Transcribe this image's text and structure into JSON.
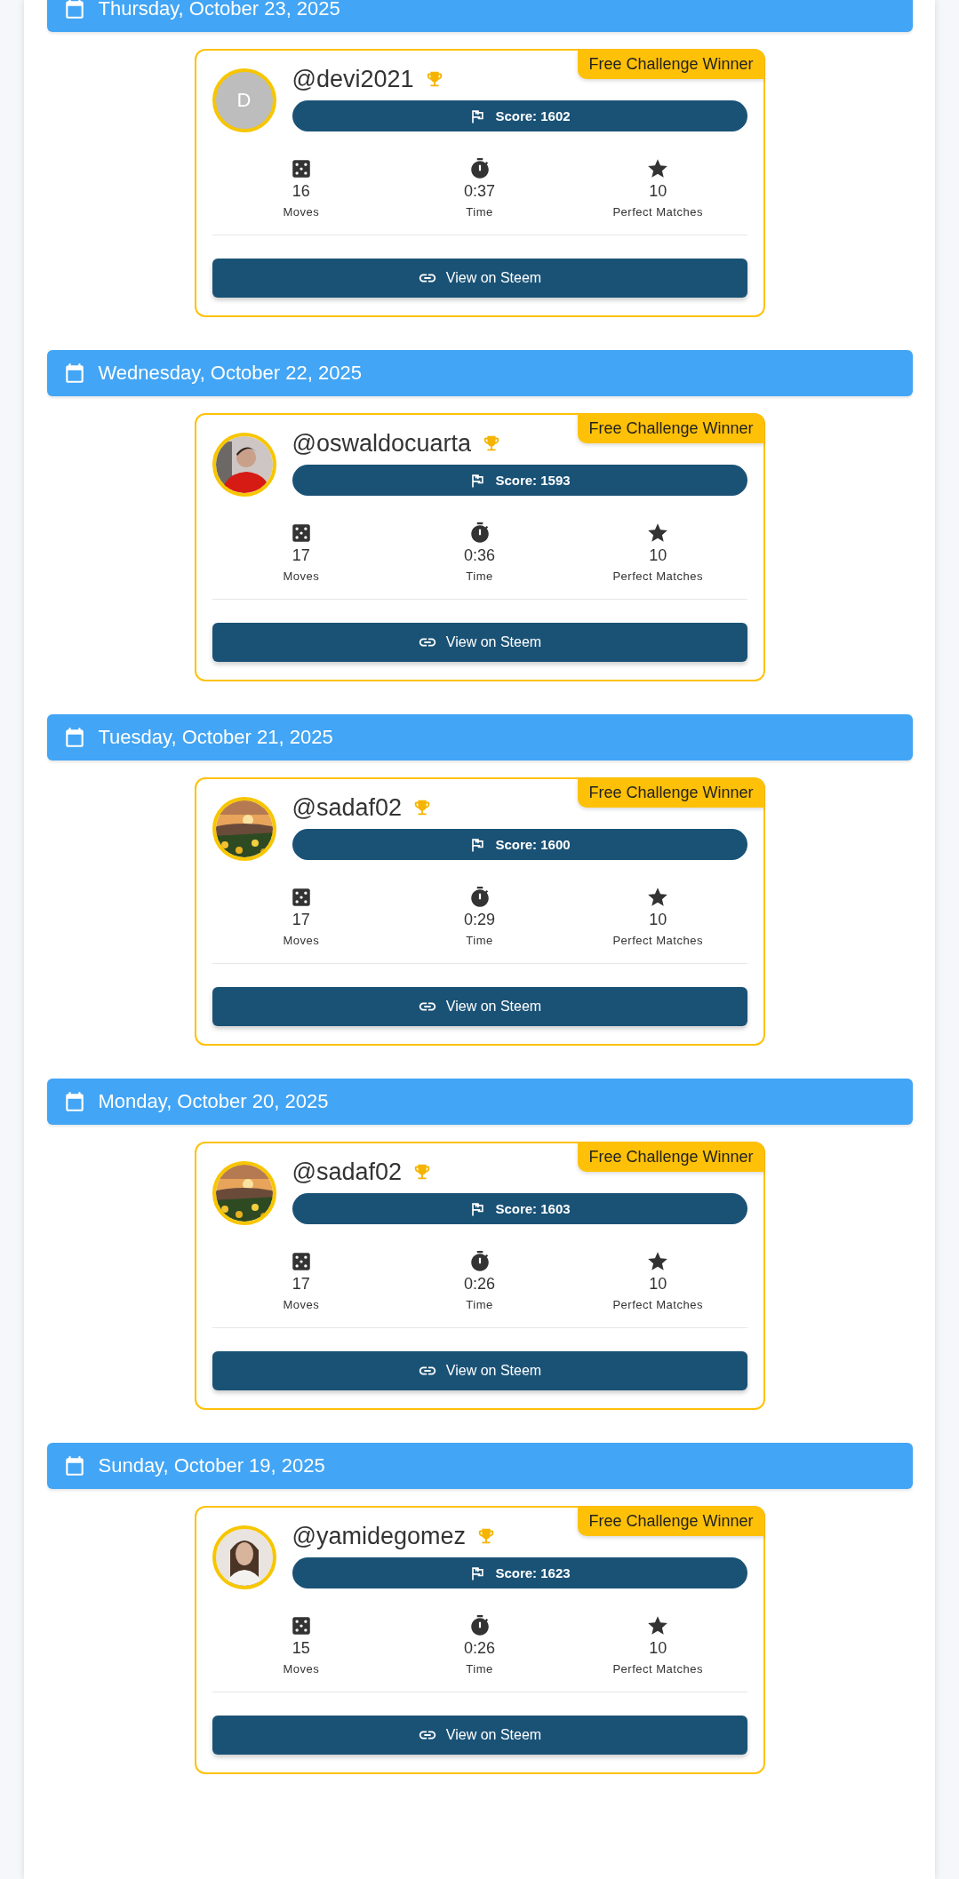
{
  "entries": [
    {
      "date": "Thursday, October 23, 2025",
      "user": "@devi2021",
      "avatar": {
        "kind": "letter",
        "initial": "D"
      },
      "badge": "Free Challenge Winner",
      "score": "Score: 1602",
      "stats": [
        {
          "kind": "moves",
          "value": "16",
          "label": "Moves"
        },
        {
          "kind": "time",
          "value": "0:37",
          "label": "Time"
        },
        {
          "kind": "matches",
          "value": "10",
          "label": "Perfect Matches"
        }
      ],
      "button": "View on Steem"
    },
    {
      "date": "Wednesday, October 22, 2025",
      "user": "@oswaldocuarta",
      "avatar": {
        "kind": "person"
      },
      "badge": "Free Challenge Winner",
      "score": "Score: 1593",
      "stats": [
        {
          "kind": "moves",
          "value": "17",
          "label": "Moves"
        },
        {
          "kind": "time",
          "value": "0:36",
          "label": "Time"
        },
        {
          "kind": "matches",
          "value": "10",
          "label": "Perfect Matches"
        }
      ],
      "button": "View on Steem"
    },
    {
      "date": "Tuesday, October 21, 2025",
      "user": "@sadaf02",
      "avatar": {
        "kind": "landscape"
      },
      "badge": "Free Challenge Winner",
      "score": "Score: 1600",
      "stats": [
        {
          "kind": "moves",
          "value": "17",
          "label": "Moves"
        },
        {
          "kind": "time",
          "value": "0:29",
          "label": "Time"
        },
        {
          "kind": "matches",
          "value": "10",
          "label": "Perfect Matches"
        }
      ],
      "button": "View on Steem"
    },
    {
      "date": "Monday, October 20, 2025",
      "user": "@sadaf02",
      "avatar": {
        "kind": "landscape"
      },
      "badge": "Free Challenge Winner",
      "score": "Score: 1603",
      "stats": [
        {
          "kind": "moves",
          "value": "17",
          "label": "Moves"
        },
        {
          "kind": "time",
          "value": "0:26",
          "label": "Time"
        },
        {
          "kind": "matches",
          "value": "10",
          "label": "Perfect Matches"
        }
      ],
      "button": "View on Steem"
    },
    {
      "date": "Sunday, October 19, 2025",
      "user": "@yamidegomez",
      "avatar": {
        "kind": "woman"
      },
      "badge": "Free Challenge Winner",
      "score": "Score: 1623",
      "stats": [
        {
          "kind": "moves",
          "value": "15",
          "label": "Moves"
        },
        {
          "kind": "time",
          "value": "0:26",
          "label": "Time"
        },
        {
          "kind": "matches",
          "value": "10",
          "label": "Perfect Matches"
        }
      ],
      "button": "View on Steem"
    }
  ]
}
